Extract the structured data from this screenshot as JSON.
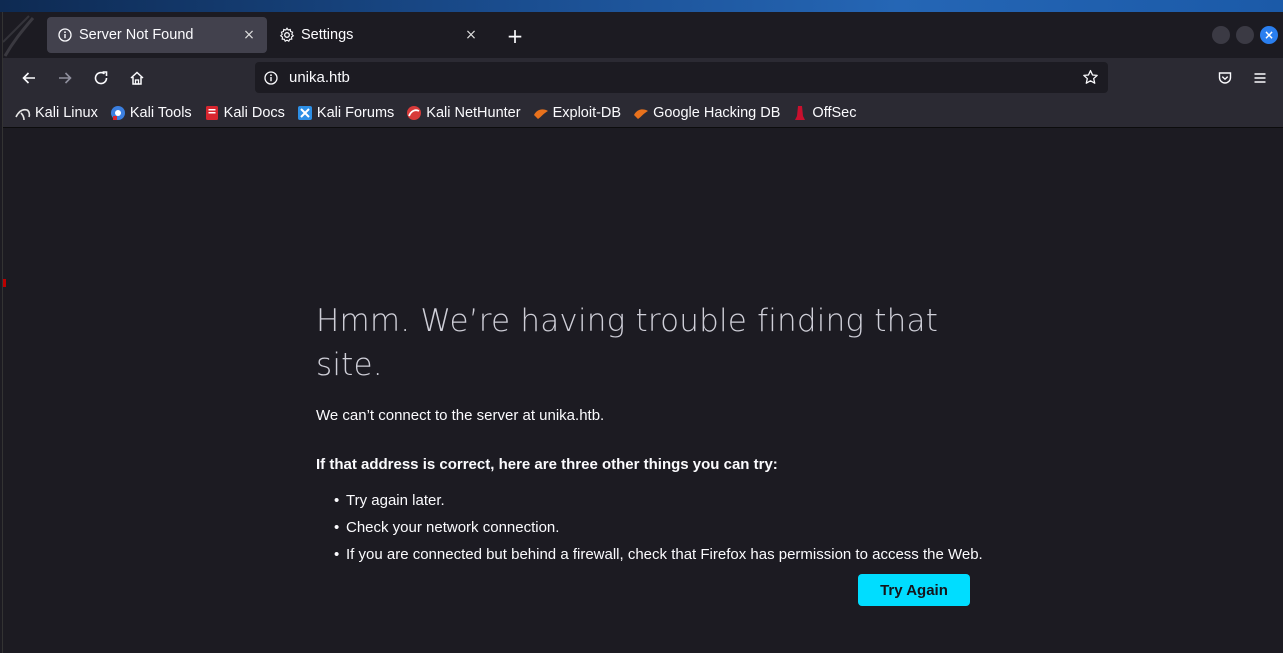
{
  "browser": {
    "tabs": [
      {
        "title": "Server Not Found",
        "icon": "info-icon",
        "active": true
      },
      {
        "title": "Settings",
        "icon": "gear-icon",
        "active": false
      }
    ],
    "new_tab_label": "+",
    "close_glyph": "×"
  },
  "navbar": {
    "url": "unika.htb"
  },
  "bookmarks": [
    {
      "label": "Kali Linux",
      "icon": "kali-dragon-icon",
      "color": "#e6e6e6"
    },
    {
      "label": "Kali Tools",
      "icon": "kali-tools-icon",
      "color": "#3b7fe0"
    },
    {
      "label": "Kali Docs",
      "icon": "kali-docs-icon",
      "color": "#d8262f"
    },
    {
      "label": "Kali Forums",
      "icon": "kali-forums-icon",
      "color": "#2d8fe6"
    },
    {
      "label": "Kali NetHunter",
      "icon": "nethunter-icon",
      "color": "#d83a3a"
    },
    {
      "label": "Exploit-DB",
      "icon": "exploit-db-icon",
      "color": "#e8711c"
    },
    {
      "label": "Google Hacking DB",
      "icon": "ghdb-icon",
      "color": "#e8711c"
    },
    {
      "label": "OffSec",
      "icon": "offsec-icon",
      "color": "#c8102e"
    }
  ],
  "error": {
    "title": "Hmm. We’re having trouble finding that site.",
    "description": "We can’t connect to the server at unika.htb.",
    "try_title": "If that address is correct, here are three other things you can try:",
    "suggestions": [
      "Try again later.",
      "Check your network connection.",
      "If you are connected but behind a firewall, check that Firefox has permission to access the Web."
    ],
    "button_label": "Try Again",
    "button_color": "#00ddff"
  }
}
